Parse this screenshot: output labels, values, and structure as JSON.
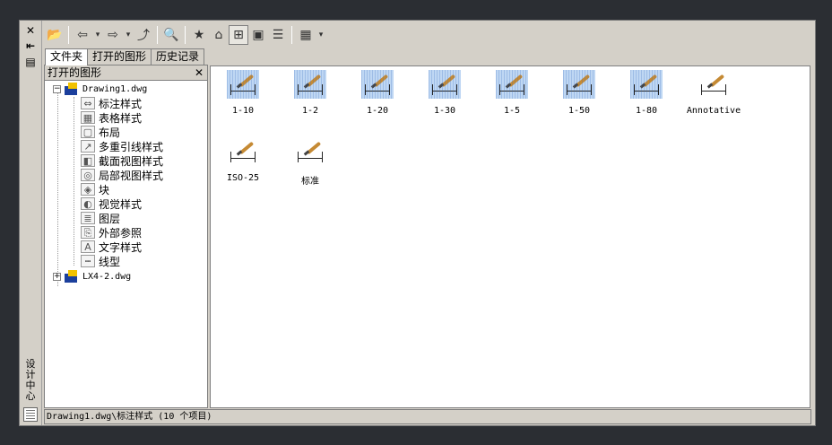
{
  "vertical_strip": {
    "close_icon": "✕",
    "pin_icon": "⇤",
    "props_icon": "▤",
    "title": "设计中心"
  },
  "toolbar": {
    "buttons": [
      {
        "name": "load-icon",
        "glyph": "📂"
      },
      {
        "name": "back-icon",
        "glyph": "⇦"
      },
      {
        "name": "back-dropdown-icon",
        "glyph": "▾"
      },
      {
        "name": "forward-icon",
        "glyph": "⇨"
      },
      {
        "name": "forward-dropdown-icon",
        "glyph": "▾"
      },
      {
        "name": "up-folder-icon",
        "glyph": "⤴"
      },
      {
        "name": "search-icon",
        "glyph": "🔍"
      },
      {
        "name": "favorites-icon",
        "glyph": "★"
      },
      {
        "name": "home-icon",
        "glyph": "⌂"
      },
      {
        "name": "tree-toggle-icon",
        "glyph": "⊞"
      },
      {
        "name": "preview-icon",
        "glyph": "▣"
      },
      {
        "name": "description-icon",
        "glyph": "☰"
      },
      {
        "name": "views-icon",
        "glyph": "▦"
      },
      {
        "name": "views-dropdown-icon",
        "glyph": "▾"
      }
    ]
  },
  "tabs": [
    {
      "label": "文件夹",
      "active": true
    },
    {
      "label": "打开的图形",
      "active": false
    },
    {
      "label": "历史记录",
      "active": false
    }
  ],
  "tree": {
    "title": "打开的图形",
    "close_glyph": "✕",
    "root1": {
      "label": "Drawing1.dwg",
      "expander": "−"
    },
    "children": [
      {
        "label": "标注样式",
        "icon": "⇔"
      },
      {
        "label": "表格样式",
        "icon": "▦"
      },
      {
        "label": "布局",
        "icon": "▢"
      },
      {
        "label": "多重引线样式",
        "icon": "↗"
      },
      {
        "label": "截面视图样式",
        "icon": "◧"
      },
      {
        "label": "局部视图样式",
        "icon": "◎"
      },
      {
        "label": "块",
        "icon": "◈"
      },
      {
        "label": "视觉样式",
        "icon": "◐"
      },
      {
        "label": "图层",
        "icon": "≣"
      },
      {
        "label": "外部参照",
        "icon": "⎘"
      },
      {
        "label": "文字样式",
        "icon": "A"
      },
      {
        "label": "线型",
        "icon": "┅"
      }
    ],
    "root2": {
      "label": "LX4-2.dwg",
      "expander": "+"
    }
  },
  "content": {
    "items": [
      {
        "label": "1-10",
        "selected": true
      },
      {
        "label": "1-2",
        "selected": true
      },
      {
        "label": "1-20",
        "selected": true
      },
      {
        "label": "1-30",
        "selected": true
      },
      {
        "label": "1-5",
        "selected": true
      },
      {
        "label": "1-50",
        "selected": true
      },
      {
        "label": "1-80",
        "selected": true
      },
      {
        "label": "Annotative",
        "selected": false
      },
      {
        "label": "ISO-25",
        "selected": false
      },
      {
        "label": "标准",
        "selected": false
      }
    ]
  },
  "status": {
    "text": "Drawing1.dwg\\标注样式 (10 个项目)"
  }
}
